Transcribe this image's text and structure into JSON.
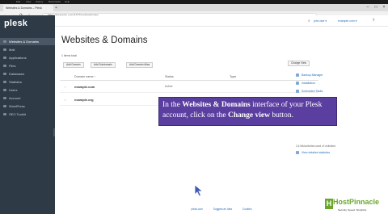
{
  "os_bar": {
    "items": [
      "Edit",
      "View",
      "History",
      "Bookmarks",
      "Help"
    ]
  },
  "browser": {
    "tab_title": "Websites & Domains – Plesk",
    "new_tab": "+",
    "url": "https://example.com:8443/smb/web/view",
    "nav_back": "←",
    "nav_forward": "→",
    "nav_reload": "⟳",
    "nav_home": "⌂",
    "min": "–",
    "max": "□",
    "close": "×"
  },
  "sidebar": {
    "logo": "plesk",
    "items": [
      {
        "label": "Websites & Domains",
        "active": true
      },
      {
        "label": "Mail",
        "active": false
      },
      {
        "label": "Applications",
        "active": false
      },
      {
        "label": "Files",
        "active": false
      },
      {
        "label": "Databases",
        "active": false
      },
      {
        "label": "Statistics",
        "active": false
      },
      {
        "label": "Users",
        "active": false
      },
      {
        "label": "Account",
        "active": false
      },
      {
        "label": "WordPress",
        "active": false
      },
      {
        "label": "SEO Toolkit",
        "active": false
      }
    ]
  },
  "topbar": {
    "search_icon": "⌕",
    "user_link": "john.doe ▾",
    "domain_link": "example.com ▾",
    "help_icon": "?"
  },
  "main": {
    "page_title": "Websites & Domains",
    "subtext": "1 items total",
    "buttons": [
      "Add Domain",
      "Add Subdomain",
      "Add Domain Alias"
    ],
    "change_view_label": "Change View",
    "columns": [
      "Domain name ↑",
      "Status",
      "Type"
    ],
    "rows": [
      {
        "domain": "example.com",
        "status": "Active"
      },
      {
        "domain": "example.org",
        "status": "Active"
      }
    ]
  },
  "right_panel": {
    "links": [
      "Backup Manager",
      "Installatron",
      "Scheduled Tasks",
      "WordPress"
    ],
    "disk_note": "2.6 Mb/unlimited used of Unlimited",
    "details_link": "View detailed statistics"
  },
  "overlay": {
    "pre": "In the ",
    "bold1": "Websites & Domains",
    "mid": " interface of your Plesk account, click on the ",
    "bold2": "Change view",
    "post": " button."
  },
  "footer": {
    "links": [
      "plesk.com",
      "Suggest an Idea",
      "Cookies"
    ]
  },
  "watermark": {
    "brand": "HostPinnacle",
    "tagline": "Security. Speed. Simplicity."
  },
  "colors": {
    "sidebar": "#2e3a46",
    "overlay": "#5b3fa0",
    "brand_green": "#6aa62e",
    "link": "#2a6ebb"
  }
}
